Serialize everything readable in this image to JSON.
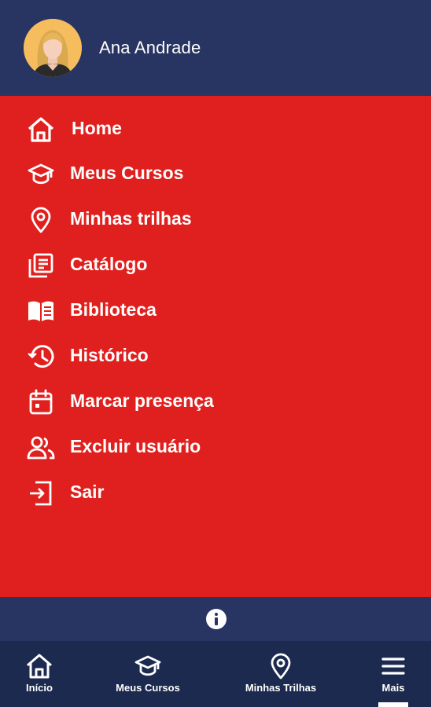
{
  "user": {
    "name": "Ana Andrade"
  },
  "menu": {
    "items": [
      {
        "label": "Home",
        "icon": "home-icon"
      },
      {
        "label": "Meus Cursos",
        "icon": "graduation-cap-icon"
      },
      {
        "label": "Minhas trilhas",
        "icon": "location-pin-icon"
      },
      {
        "label": "Catálogo",
        "icon": "catalog-icon"
      },
      {
        "label": "Biblioteca",
        "icon": "book-icon"
      },
      {
        "label": "Histórico",
        "icon": "history-icon"
      },
      {
        "label": "Marcar presença",
        "icon": "calendar-icon"
      },
      {
        "label": "Excluir usuário",
        "icon": "users-icon"
      },
      {
        "label": "Sair",
        "icon": "logout-icon"
      }
    ]
  },
  "bottom_nav": {
    "items": [
      {
        "label": "Início",
        "icon": "home-icon"
      },
      {
        "label": "Meus Cursos",
        "icon": "graduation-cap-icon"
      },
      {
        "label": "Minhas Trilhas",
        "icon": "location-pin-icon"
      },
      {
        "label": "Mais",
        "icon": "menu-icon",
        "active": true
      }
    ]
  },
  "colors": {
    "header_bg": "#283462",
    "menu_bg": "#e0201e",
    "nav_bg": "#1d2a4f",
    "text": "#ffffff"
  }
}
